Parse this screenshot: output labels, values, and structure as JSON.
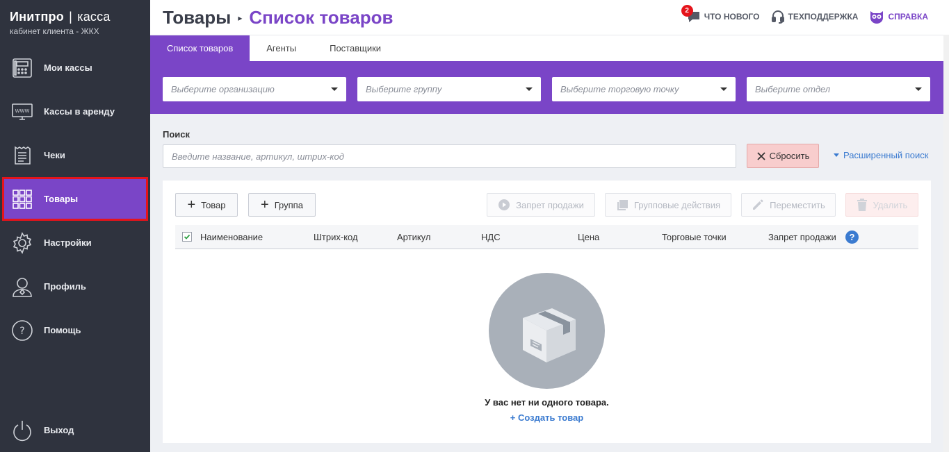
{
  "brand": {
    "name_bold": "Инитпро",
    "separator": "|",
    "name_light": "касса",
    "subtitle": "кабинет клиента - ЖКХ"
  },
  "sidebar": {
    "items": [
      {
        "label": "Мои кассы",
        "icon": "cash-register-icon"
      },
      {
        "label": "Кассы в аренду",
        "icon": "monitor-www-icon"
      },
      {
        "label": "Чеки",
        "icon": "receipt-icon"
      },
      {
        "label": "Товары",
        "icon": "grid-icon",
        "active": true
      },
      {
        "label": "Настройки",
        "icon": "gear-icon"
      },
      {
        "label": "Профиль",
        "icon": "user-icon"
      },
      {
        "label": "Помощь",
        "icon": "question-icon"
      }
    ],
    "logout": {
      "label": "Выход",
      "icon": "power-icon"
    }
  },
  "header": {
    "breadcrumb_root": "Товары",
    "breadcrumb_arrow": "▸",
    "breadcrumb_current": "Список товаров",
    "whats_new": {
      "label": "ЧТО НОВОГО",
      "badge": "2"
    },
    "support": {
      "label": "ТЕХПОДДЕРЖКА"
    },
    "help": {
      "label": "СПРАВКА"
    }
  },
  "tabs": [
    {
      "label": "Список товаров",
      "active": true
    },
    {
      "label": "Агенты"
    },
    {
      "label": "Поставщики"
    }
  ],
  "filters": {
    "organization": "Выберите организацию",
    "group": "Выберите группу",
    "outlet": "Выберите торговую точку",
    "department": "Выберите отдел"
  },
  "search": {
    "label": "Поиск",
    "placeholder": "Введите название, артикул, штрих-код",
    "value": "",
    "reset_label": "Сбросить",
    "advanced_label": "Расширенный поиск"
  },
  "toolbar": {
    "add_product": "Товар",
    "add_group": "Группа",
    "ban_sale": "Запрет продажи",
    "group_actions": "Групповые действия",
    "move": "Переместить",
    "delete": "Удалить"
  },
  "table": {
    "columns": [
      "Наименование",
      "Штрих-код",
      "Артикул",
      "НДС",
      "Цена",
      "Торговые точки",
      "Запрет продажи"
    ],
    "help_glyph": "?"
  },
  "empty_state": {
    "message": "У вас нет ни одного товара.",
    "create_link": "+ Создать товар"
  },
  "colors": {
    "accent": "#7a45c7",
    "sidebar_bg": "#2f333e",
    "link": "#3b7bd0",
    "danger": "#e5141b",
    "reset_bg": "#f8cdcd"
  }
}
